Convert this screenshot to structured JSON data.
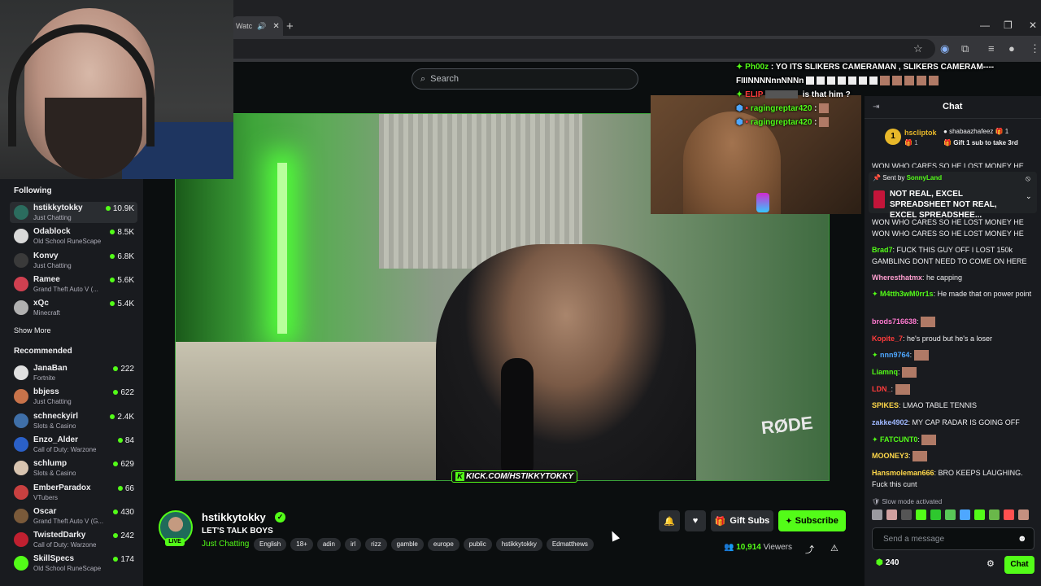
{
  "browser": {
    "tab_label": "Watc",
    "tab_sound_icon": "speaker-icon",
    "newtab_glyph": "+",
    "min_glyph": "—",
    "max_glyph": "❐",
    "close_glyph": "✕"
  },
  "search": {
    "placeholder": "Search"
  },
  "sidebar": {
    "following_title": "Following",
    "following": [
      {
        "name": "hstikkytokky",
        "category": "Just Chatting",
        "viewers": "10.9K",
        "color": "#2b6c5e"
      },
      {
        "name": "Odablock",
        "category": "Old School RuneScape",
        "viewers": "8.5K",
        "color": "#d9d9d9"
      },
      {
        "name": "Konvy",
        "category": "Just Chatting",
        "viewers": "6.8K",
        "color": "#3a3a3a"
      },
      {
        "name": "Ramee",
        "category": "Grand Theft Auto V (...",
        "viewers": "5.6K",
        "color": "#d04050"
      },
      {
        "name": "xQc",
        "category": "Minecraft",
        "viewers": "5.4K",
        "color": "#b0b0b0"
      }
    ],
    "show_more": "Show More",
    "recommended_title": "Recommended",
    "recommended": [
      {
        "name": "JanaBan",
        "category": "Fortnite",
        "viewers": "222",
        "color": "#e0e0e0"
      },
      {
        "name": "bbjess",
        "category": "Just Chatting",
        "viewers": "622",
        "color": "#c8734a"
      },
      {
        "name": "schneckyirl",
        "category": "Slots & Casino",
        "viewers": "2.4K",
        "color": "#3f6fa8"
      },
      {
        "name": "Enzo_Alder",
        "category": "Call of Duty: Warzone",
        "viewers": "84",
        "color": "#2a60c8"
      },
      {
        "name": "schlump",
        "category": "Slots & Casino",
        "viewers": "629",
        "color": "#d8c4b0"
      },
      {
        "name": "EmberParadox",
        "category": "VTubers",
        "viewers": "66",
        "color": "#c84040"
      },
      {
        "name": "Oscar",
        "category": "Grand Theft Auto V (G...",
        "viewers": "430",
        "color": "#7a5a3a"
      },
      {
        "name": "TwistedDarky",
        "category": "Call of Duty: Warzone",
        "viewers": "242",
        "color": "#c02030"
      },
      {
        "name": "SkillSpecs",
        "category": "Old School RuneScape",
        "viewers": "174",
        "color": "#53fc18"
      }
    ]
  },
  "video": {
    "overlay_url": "KICK.COM/HSTIKKYTOKKY",
    "brand": "RØDE"
  },
  "overlay_chat": [
    {
      "user": "Ph00z",
      "text": " : YO ITS SLIKERS CAMERAMAN , SLIKERS CAMERAM----"
    },
    {
      "user": "",
      "text": "FIIINNNNnnNNNn"
    },
    {
      "user": "ELIP",
      "text": "is that him ?"
    },
    {
      "user": "ragingreptar420",
      "text": " :"
    },
    {
      "user": "ragingreptar420",
      "text": " :"
    }
  ],
  "stream": {
    "streamer": "hstikkytokky",
    "live_badge": "LIVE",
    "title": "LET'S TALK BOYS",
    "category": "Just Chatting",
    "tags": [
      "English",
      "18+",
      "adin",
      "irl",
      "rizz",
      "gamble",
      "europe",
      "public",
      "hstikkytokky",
      "Edmatthews"
    ],
    "viewers_count": "10,914",
    "viewers_label": "Viewers",
    "gift_label": "Gift Subs",
    "subscribe_label": "Subscribe"
  },
  "chat": {
    "title": "Chat",
    "leaderboard": {
      "rank": "1",
      "name": "hscliptok",
      "count": "1",
      "user2": "shabaazhafeez",
      "user2_count": "1",
      "gift_text": "Gift 1 sub to take 3rd"
    },
    "top_overflow": "WON WHO CARES SO HE LOST MONEY HE",
    "pinned": {
      "sent_by_label": "Sent by",
      "sender": "SonnyLand",
      "text": "NOT REAL, EXCEL SPREADSHEET NOT REAL, EXCEL SPREADSHEE..."
    },
    "messages": [
      {
        "user": "",
        "text": "WON WHO CARES SO HE LOST MONEY HE WON WHO CARES SO HE LOST MONEY HE WO",
        "color": "#efeff1"
      },
      {
        "user": "Brad7",
        "text": ": FUCK THIS GUY OFF I LOST 150k GAMBLING DONT NEED TO COME ON HERE",
        "color": "#53fc18"
      },
      {
        "user": "Wheresthatmx",
        "text": ": he capping",
        "color": "#ff9fd0"
      },
      {
        "user": "M4tth3wM0rr1s",
        "text": ": He made that on power point",
        "color": "#53fc18"
      },
      {
        "user": "brods716638",
        "text": ":",
        "color": "#ff7ad0"
      },
      {
        "user": "Kopite_7",
        "text": ": he's proud but he's a loser",
        "color": "#ff3b3b"
      },
      {
        "user": "nnn9764",
        "text": ":",
        "color": "#4ea7ff"
      },
      {
        "user": "Liamnq",
        "text": ":",
        "color": "#53fc18"
      },
      {
        "user": "LDN_",
        "text": ":",
        "color": "#ff3b3b"
      },
      {
        "user": "SPIKES",
        "text": ": LMAO TABLE TENNIS",
        "color": "#ffd84a"
      },
      {
        "user": "zakke4902",
        "text": ": MY CAP RADAR IS GOING OFF",
        "color": "#9fb8ff"
      },
      {
        "user": "FATCUNT0",
        "text": ":",
        "color": "#53fc18"
      },
      {
        "user": "MOONEY3",
        "text": ":",
        "color": "#ffd84a"
      },
      {
        "user": "Hansmoleman666",
        "text": ": BRO KEEPS LAUGHING. Fuck this cunt",
        "color": "#ffd84a"
      }
    ],
    "slow_mode": "Slow mode activated",
    "send_placeholder": "Send a message",
    "points": "240",
    "chat_button": "Chat"
  },
  "colors": {
    "accent": "#53fc18",
    "panel": "#191b1f",
    "background": "#0b0e0f"
  }
}
